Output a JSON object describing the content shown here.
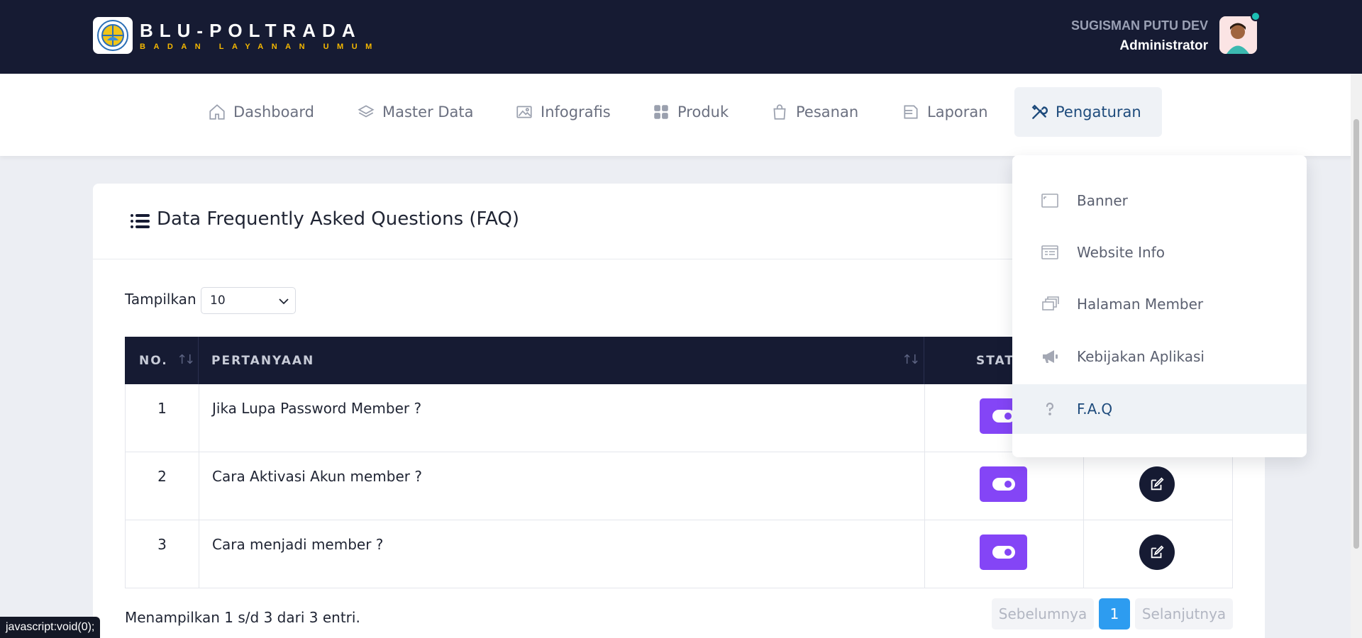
{
  "header": {
    "brand_title": "BLU-POLTRADA",
    "brand_subtitle": "BADAN LAYANAN UMUM",
    "user_name": "SUGISMAN PUTU DEV",
    "user_role": "Administrator"
  },
  "nav": {
    "items": [
      {
        "label": "Dashboard",
        "icon": "home-icon"
      },
      {
        "label": "Master Data",
        "icon": "layers-icon"
      },
      {
        "label": "Infografis",
        "icon": "image-icon"
      },
      {
        "label": "Produk",
        "icon": "grid-icon"
      },
      {
        "label": "Pesanan",
        "icon": "bag-icon"
      },
      {
        "label": "Laporan",
        "icon": "document-icon"
      },
      {
        "label": "Pengaturan",
        "icon": "tools-icon",
        "active": true
      }
    ]
  },
  "dropdown": {
    "items": [
      {
        "label": "Banner",
        "icon": "banner-icon"
      },
      {
        "label": "Website Info",
        "icon": "website-info-icon"
      },
      {
        "label": "Halaman Member",
        "icon": "pages-icon"
      },
      {
        "label": "Kebijakan Aplikasi",
        "icon": "megaphone-icon"
      },
      {
        "label": "F.A.Q",
        "icon": "question-icon",
        "active": true
      }
    ]
  },
  "card": {
    "title": "Data Frequently Asked Questions (FAQ)",
    "length_label": "Tampilkan",
    "length_value": "10",
    "columns": [
      "NO.",
      "PERTANYAAN",
      "STAT"
    ],
    "rows": [
      {
        "no": "1",
        "question": "Jika Lupa Password Member ?"
      },
      {
        "no": "2",
        "question": "Cara Aktivasi Akun member ?"
      },
      {
        "no": "3",
        "question": "Cara menjadi member ?"
      }
    ],
    "info": "Menampilkan 1 s/d 3 dari 3 entri.",
    "pagination": {
      "prev": "Sebelumnya",
      "current": "1",
      "next": "Selanjutnya"
    }
  },
  "status_url": "javascript:void(0);",
  "colors": {
    "header_bg": "#161b33",
    "accent_yellow": "#f5b800",
    "toggle_purple": "#8445f6",
    "pagination_active": "#2d9cf0",
    "nav_active": "#1e4b7c"
  }
}
